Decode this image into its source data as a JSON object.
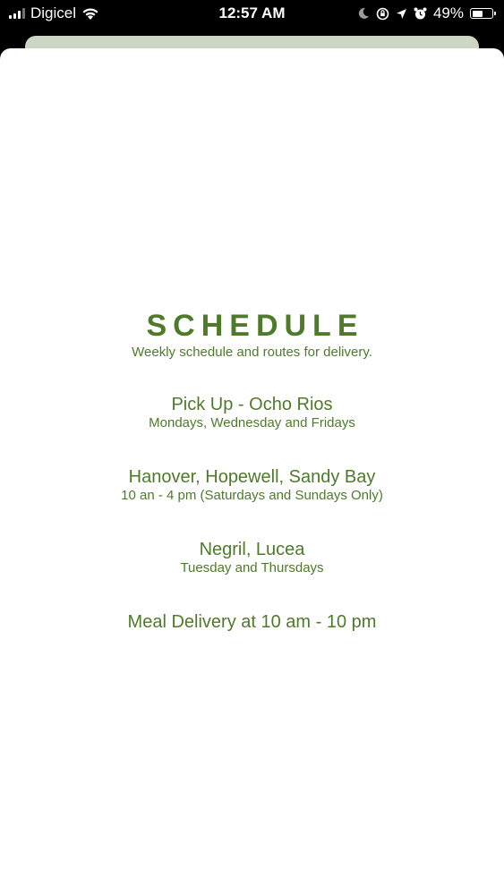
{
  "status_bar": {
    "carrier": "Digicel",
    "time": "12:57 AM",
    "battery_percent": "49%",
    "battery_level": 0.49,
    "icons": [
      "signal-icon",
      "wifi-icon",
      "moon-icon",
      "orientation-lock-icon",
      "location-arrow-icon",
      "alarm-icon",
      "battery-icon"
    ]
  },
  "schedule": {
    "title": "SCHEDULE",
    "subtitle": "Weekly schedule and routes for delivery.",
    "entries": [
      {
        "title": "Pick Up - Ocho Rios",
        "detail": "Mondays, Wednesday and Fridays"
      },
      {
        "title": "Hanover, Hopewell, Sandy Bay",
        "detail": "10 an - 4 pm (Saturdays and Sundays Only)"
      },
      {
        "title": "Negril, Lucea",
        "detail": "Tuesday and Thursdays"
      },
      {
        "title": "Meal Delivery at 10 am - 10 pm"
      }
    ]
  },
  "colors": {
    "accent_green": "#4f7a2b",
    "back_card": "#ccd6c2",
    "sheet": "#ffffff"
  }
}
